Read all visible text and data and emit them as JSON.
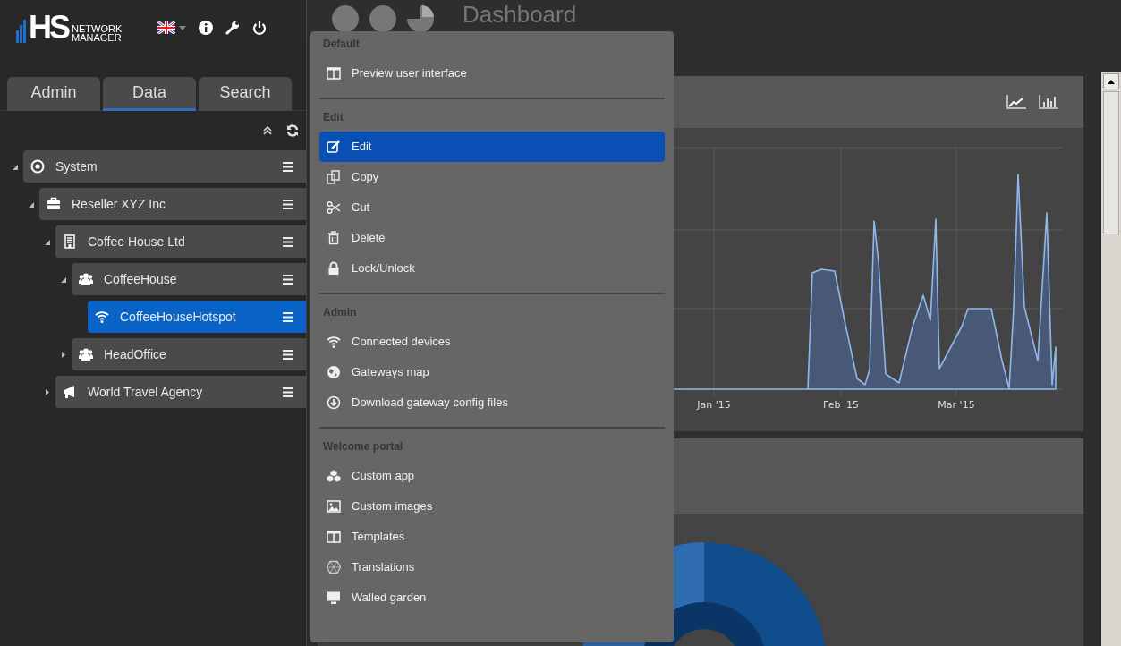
{
  "header": {
    "logo_mark": "HS",
    "logo_line_1": "NETWORK",
    "logo_line_2": "MANAGER"
  },
  "tabs": [
    {
      "label": "Admin",
      "selected": false
    },
    {
      "label": "Data",
      "selected": true
    },
    {
      "label": "Search",
      "selected": false
    }
  ],
  "tree": [
    {
      "label": "System",
      "kind": "system",
      "expanded": true,
      "selected": false,
      "children": [
        {
          "label": "Reseller XYZ Inc",
          "kind": "reseller",
          "expanded": true,
          "selected": false,
          "children": [
            {
              "label": "Coffee House Ltd",
              "kind": "company",
              "expanded": true,
              "selected": false,
              "children": [
                {
                  "label": "CoffeeHouse",
                  "kind": "group",
                  "expanded": true,
                  "selected": false,
                  "children": [
                    {
                      "label": "CoffeeHouseHotspot",
                      "kind": "hotspot",
                      "selected": true
                    }
                  ]
                },
                {
                  "label": "HeadOffice",
                  "kind": "group",
                  "expanded": false,
                  "selected": false
                }
              ]
            },
            {
              "label": "World Travel Agency",
              "kind": "agency",
              "expanded": false,
              "selected": false
            }
          ]
        }
      ]
    }
  ],
  "dashboard": {
    "title": "Dashboard",
    "chart_panel": {
      "x_labels": [
        "Jan '15",
        "Feb '15",
        "Mar '15"
      ]
    }
  },
  "context_menu": {
    "sections": [
      {
        "title": "Default",
        "items": [
          {
            "label": "Preview user interface",
            "kind": "columns",
            "selected": false
          }
        ]
      },
      {
        "title": "Edit",
        "items": [
          {
            "label": "Edit",
            "kind": "edit",
            "selected": true
          },
          {
            "label": "Copy",
            "kind": "copy",
            "selected": false
          },
          {
            "label": "Cut",
            "kind": "cut",
            "selected": false
          },
          {
            "label": "Delete",
            "kind": "trash",
            "selected": false
          },
          {
            "label": "Lock/Unlock",
            "kind": "lock",
            "selected": false
          }
        ]
      },
      {
        "title": "Admin",
        "items": [
          {
            "label": "Connected devices",
            "kind": "wifi",
            "selected": false
          },
          {
            "label": "Gateways map",
            "kind": "globe",
            "selected": false
          },
          {
            "label": "Download gateway config files",
            "kind": "download",
            "selected": false
          }
        ]
      },
      {
        "title": "Welcome portal",
        "items": [
          {
            "label": "Custom app",
            "kind": "cubes",
            "selected": false
          },
          {
            "label": "Custom images",
            "kind": "image",
            "selected": false
          },
          {
            "label": "Templates",
            "kind": "columns",
            "selected": false
          },
          {
            "label": "Translations",
            "kind": "hexagon",
            "selected": false
          },
          {
            "label": "Walled garden",
            "kind": "monitor",
            "selected": false
          }
        ]
      }
    ]
  }
}
